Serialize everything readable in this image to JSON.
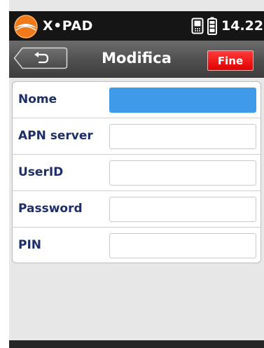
{
  "statusbar": {
    "brand": "X•PAD",
    "time": "14.22"
  },
  "titlebar": {
    "title": "Modifica",
    "done_label": "Fine"
  },
  "form": {
    "fields": [
      {
        "label": "Nome",
        "value": "",
        "focused": true
      },
      {
        "label": "APN server",
        "value": ""
      },
      {
        "label": "UserID",
        "value": ""
      },
      {
        "label": "Password",
        "value": ""
      },
      {
        "label": "PIN",
        "value": ""
      }
    ]
  },
  "colors": {
    "accent_focus": "#3f9bea",
    "done_button": "#e00000",
    "label_text": "#1d2e68",
    "logo_orange": "#f07a1a"
  }
}
